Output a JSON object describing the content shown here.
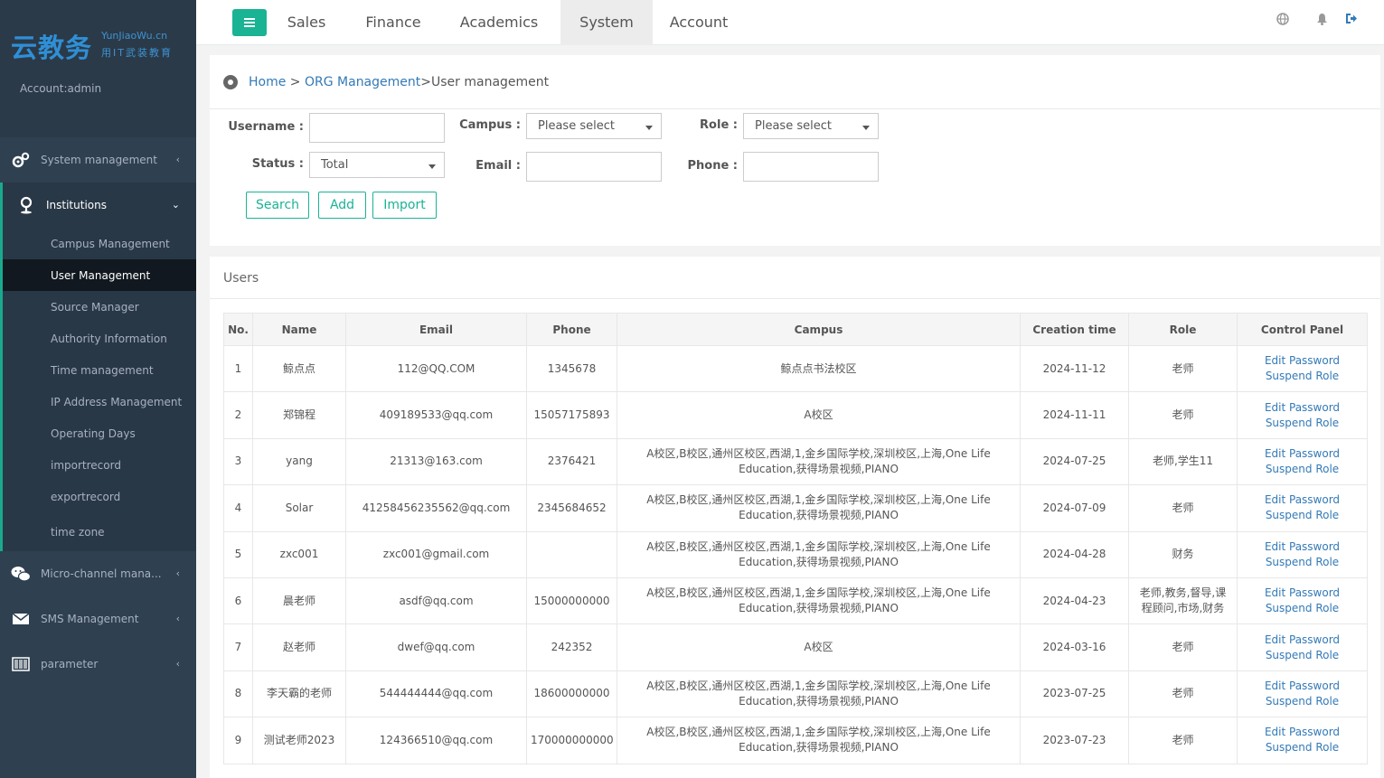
{
  "logo": {
    "main": "云教务",
    "en": "YunJiaoWu.cn",
    "cn": "用IT武装教育"
  },
  "account_label": "Account:admin",
  "sidebar": {
    "system_management": "System management",
    "institutions": "Institutions",
    "sub_items": [
      "Campus Management",
      "User Management",
      "Source Manager",
      "Authority Information",
      "Time management",
      "IP Address Management",
      "Operating Days",
      "importrecord",
      "exportrecord",
      "time zone"
    ],
    "micro_channel": "Micro-channel mana...",
    "sms": "SMS Management",
    "parameter": "parameter"
  },
  "topnav": {
    "tabs": [
      "Sales",
      "Finance",
      "Academics",
      "System",
      "Account"
    ],
    "active": "System"
  },
  "breadcrumb": {
    "home": "Home",
    "sep1": " > ",
    "org": "ORG Management",
    "current": " >User management"
  },
  "filters": {
    "username_label": "Username :",
    "username_value": "",
    "campus_label": "Campus :",
    "campus_value": "Please select",
    "role_label": "Role :",
    "role_value": "Please select",
    "status_label": "Status :",
    "status_value": "Total",
    "email_label": "Email :",
    "email_value": "",
    "phone_label": "Phone :",
    "phone_value": ""
  },
  "buttons": {
    "search": "Search",
    "add": "Add",
    "import": "Import"
  },
  "users_title": "Users",
  "table": {
    "headers": [
      "No.",
      "Name",
      "Email",
      "Phone",
      "Campus",
      "Creation time",
      "Role",
      "Control Panel"
    ],
    "edit_password": "Edit Password",
    "suspend_role": "Suspend Role",
    "rows": [
      {
        "no": "1",
        "name": "鲸点点",
        "email": "112@QQ.COM",
        "phone": "1345678",
        "campus": "鲸点点书法校区",
        "time": "2024-11-12",
        "role": "老师"
      },
      {
        "no": "2",
        "name": "郑锦程",
        "email": "409189533@qq.com",
        "phone": "15057175893",
        "campus": "A校区",
        "time": "2024-11-11",
        "role": "老师"
      },
      {
        "no": "3",
        "name": "yang",
        "email": "21313@163.com",
        "phone": "2376421",
        "campus": "A校区,B校区,通州区校区,西湖,1,金乡国际学校,深圳校区,上海,One Life Education,获得场景视频,PIANO",
        "time": "2024-07-25",
        "role": "老师,学生11"
      },
      {
        "no": "4",
        "name": "Solar",
        "email": "41258456235562@qq.com",
        "phone": "2345684652",
        "campus": "A校区,B校区,通州区校区,西湖,1,金乡国际学校,深圳校区,上海,One Life Education,获得场景视频,PIANO",
        "time": "2024-07-09",
        "role": "老师"
      },
      {
        "no": "5",
        "name": "zxc001",
        "email": "zxc001@gmail.com",
        "phone": "",
        "campus": "A校区,B校区,通州区校区,西湖,1,金乡国际学校,深圳校区,上海,One Life Education,获得场景视频,PIANO",
        "time": "2024-04-28",
        "role": "财务"
      },
      {
        "no": "6",
        "name": "晨老师",
        "email": "asdf@qq.com",
        "phone": "15000000000",
        "campus": "A校区,B校区,通州区校区,西湖,1,金乡国际学校,深圳校区,上海,One Life Education,获得场景视频,PIANO",
        "time": "2024-04-23",
        "role": "老师,教务,督导,课程顾问,市场,财务"
      },
      {
        "no": "7",
        "name": "赵老师",
        "email": "dwef@qq.com",
        "phone": "242352",
        "campus": "A校区",
        "time": "2024-03-16",
        "role": "老师"
      },
      {
        "no": "8",
        "name": "李天霸的老师",
        "email": "544444444@qq.com",
        "phone": "18600000000",
        "campus": "A校区,B校区,通州区校区,西湖,1,金乡国际学校,深圳校区,上海,One Life Education,获得场景视频,PIANO",
        "time": "2023-07-25",
        "role": "老师"
      },
      {
        "no": "9",
        "name": "测试老师2023",
        "email": "124366510@qq.com",
        "phone": "170000000000",
        "campus": "A校区,B校区,通州区校区,西湖,1,金乡国际学校,深圳校区,上海,One Life Education,获得场景视频,PIANO",
        "time": "2023-07-23",
        "role": "老师"
      }
    ]
  }
}
